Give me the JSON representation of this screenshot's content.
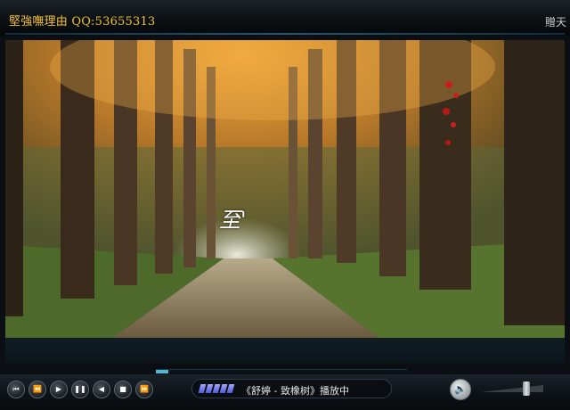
{
  "window": {
    "title": "堅強嘸理由 QQ:53655313",
    "title_right": "贈天"
  },
  "video": {
    "lyric_text": "至'"
  },
  "playback": {
    "progress": 0.05,
    "status_text": "《舒婷 - 致橡树》播放中",
    "volume": 0.8
  },
  "controls": {
    "icons": [
      "previous-icon",
      "rewind-icon",
      "play-icon",
      "pause-icon",
      "step-back-icon",
      "stop-icon",
      "fast-forward-icon",
      "volume-icon"
    ]
  },
  "colors": {
    "title": "#f0c030",
    "accent": "#4ab8d8"
  }
}
